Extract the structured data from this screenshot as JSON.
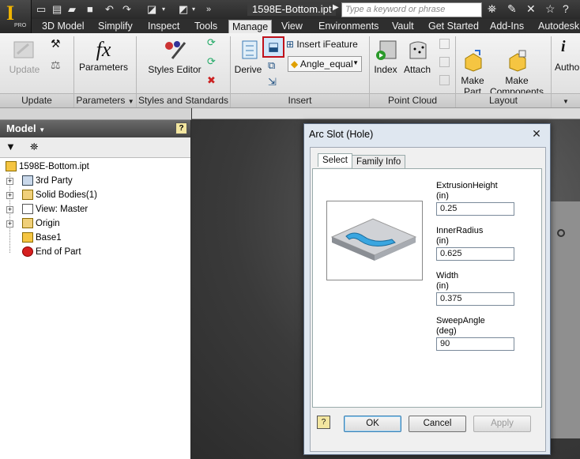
{
  "app": {
    "logo_label": "PRO",
    "file_title": "1598E-Bottom.ipt"
  },
  "search": {
    "placeholder": "Type a keyword or phrase"
  },
  "menu_tabs": [
    "3D Model",
    "Simplify",
    "Inspect",
    "Tools",
    "Manage",
    "View",
    "Environments",
    "Vault",
    "Get Started",
    "Add-Ins",
    "Autodesk"
  ],
  "active_tab": "Manage",
  "ribbon": {
    "update": {
      "label": "Update"
    },
    "parameters": {
      "label": "Parameters"
    },
    "styles_editor": {
      "label": "Styles Editor"
    },
    "derive": {
      "label": "Derive"
    },
    "insert_ifeature": {
      "label": "Insert iFeature"
    },
    "ifeature_combo": {
      "value": "Angle_equal"
    },
    "index": {
      "label": "Index"
    },
    "attach": {
      "label": "Attach"
    },
    "make_part": {
      "label": "Make\nPart"
    },
    "make_components": {
      "label": "Make\nComponents"
    },
    "author": {
      "label": "Autho"
    },
    "panels": [
      "Update",
      "Parameters",
      "Styles and Standards",
      "Insert",
      "Point Cloud",
      "Layout"
    ]
  },
  "browser": {
    "title": "Model",
    "items": [
      {
        "label": "1598E-Bottom.ipt"
      },
      {
        "label": "3rd Party"
      },
      {
        "label": "Solid Bodies(1)"
      },
      {
        "label": "View: Master"
      },
      {
        "label": "Origin"
      },
      {
        "label": "Base1"
      },
      {
        "label": "End of Part"
      }
    ]
  },
  "dialog": {
    "title": "Arc Slot (Hole)",
    "tabs": [
      "Select",
      "Family Info"
    ],
    "params": [
      {
        "name": "ExtrusionHeight",
        "unit": "(in)",
        "value": "0.25"
      },
      {
        "name": "InnerRadius",
        "unit": "(in)",
        "value": "0.625"
      },
      {
        "name": "Width",
        "unit": "(in)",
        "value": "0.375"
      },
      {
        "name": "SweepAngle",
        "unit": "(deg)",
        "value": "90"
      }
    ],
    "buttons": {
      "ok": "OK",
      "cancel": "Cancel",
      "apply": "Apply"
    }
  }
}
